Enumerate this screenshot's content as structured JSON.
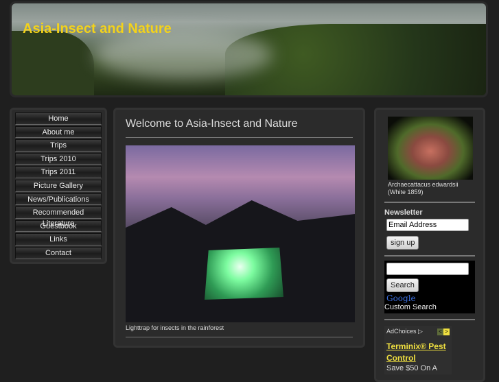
{
  "site": {
    "title": "Asia-Insect and Nature"
  },
  "nav": [
    "Home",
    "About me",
    "Trips",
    "Trips 2010",
    "Trips 2011",
    "Picture Gallery",
    "News/Publications",
    "Recommended Literature",
    "Guestbook",
    "Links",
    "Contact"
  ],
  "main": {
    "heading": "Welcome to Asia-Insect and Nature",
    "photo_caption": "Lighttrap for insects in the rainforest"
  },
  "sidebar": {
    "moth_caption_1": "Archaecattacus edwardsii",
    "moth_caption_2": "(White 1859)",
    "newsletter_title": "Newsletter",
    "email_placeholder": "Email Address",
    "signup": "sign up",
    "search_button": "Search",
    "google": "Google",
    "custom_search": "Custom Search",
    "adchoices": "AdChoices",
    "ad_title": "Terminix® Pest Control",
    "ad_text": "Save $50 On A"
  }
}
